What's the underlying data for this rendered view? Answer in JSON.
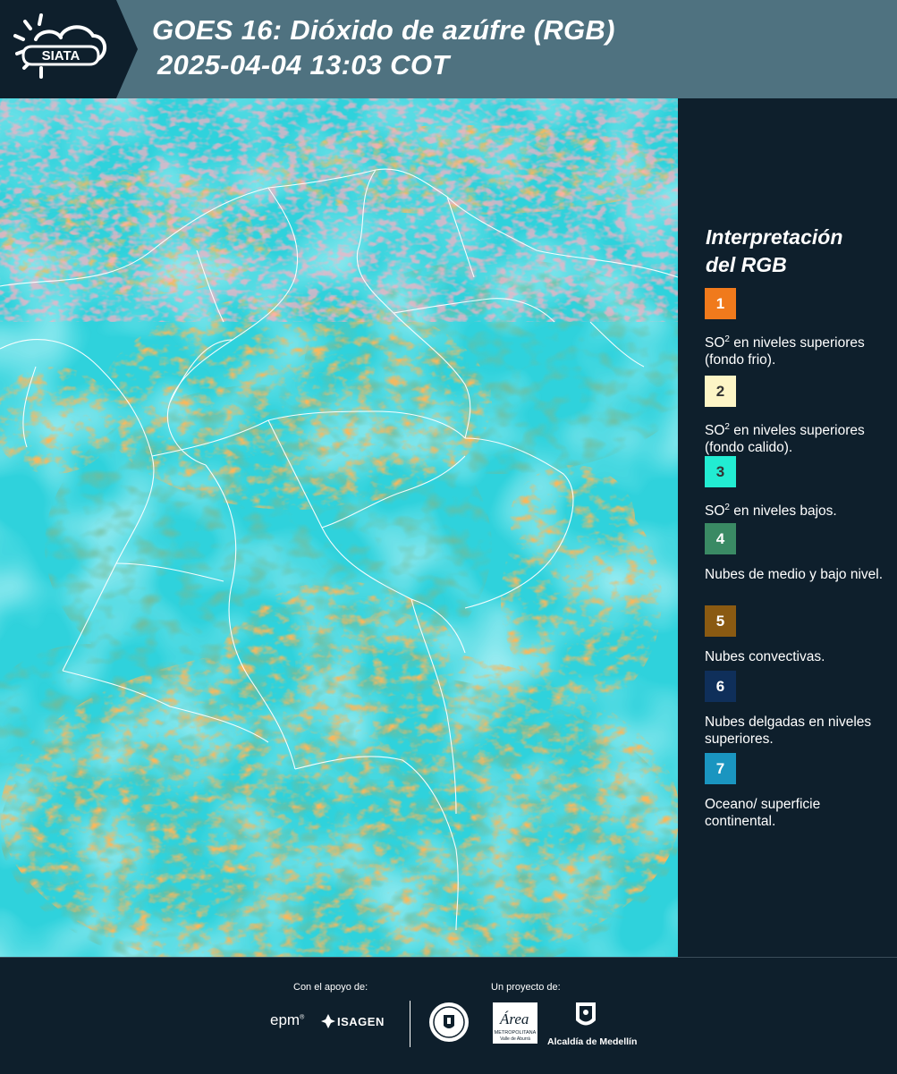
{
  "header": {
    "logo_text": "SIATA",
    "title_line1": "GOES 16: Dióxido de azúfre (RGB)",
    "title_line2": "2025-04-04 13:03 COT"
  },
  "legend": {
    "title_line1": "Interpretación",
    "title_line2": "del RGB",
    "items": [
      {
        "number": "1",
        "color": "#f07a1c",
        "number_color": "#ffffff",
        "text_before": "SO",
        "text_sup": "2",
        "text_after": " en niveles superiores (fondo frio)."
      },
      {
        "number": "2",
        "color": "#fdf5c6",
        "number_color": "#333333",
        "text_before": "SO",
        "text_sup": "2",
        "text_after": " en niveles superiores (fondo calido)."
      },
      {
        "number": "3",
        "color": "#22ecd2",
        "number_color": "#333333",
        "text_before": "SO",
        "text_sup": "2",
        "text_after": " en niveles bajos."
      },
      {
        "number": "4",
        "color": "#3a8a64",
        "number_color": "#ffffff",
        "text_before": "Nubes de medio y bajo nivel.",
        "text_sup": "",
        "text_after": ""
      },
      {
        "number": "5",
        "color": "#8a5a12",
        "number_color": "#ffffff",
        "text_before": "Nubes convectivas.",
        "text_sup": "",
        "text_after": ""
      },
      {
        "number": "6",
        "color": "#0f2f5a",
        "number_color": "#ffffff",
        "text_before": "Nubes delgadas en niveles superiores.",
        "text_sup": "",
        "text_after": ""
      },
      {
        "number": "7",
        "color": "#1a95c0",
        "number_color": "#ffffff",
        "text_before": "Oceano/ superficie continental.",
        "text_sup": "",
        "text_after": ""
      }
    ]
  },
  "footer": {
    "support_caption": "Con el apoyo de:",
    "project_caption": "Un proyecto de:",
    "epm_logo": "epm",
    "isagen_logo": "ISAGEN",
    "metropolitana_logo_lines": [
      "Área",
      "METROPOLITANA",
      "Valle de Aburrá"
    ],
    "alcaldia_logo": "Alcaldía de Medellín"
  },
  "map_image": {
    "description_icon": "satellite-rgb-image",
    "colors": {
      "sea": "#2fd2dc",
      "orange": "#f07a1c",
      "green": "#2e7d4e",
      "pink": "#ff6e8a",
      "border": "#ffffff"
    }
  }
}
